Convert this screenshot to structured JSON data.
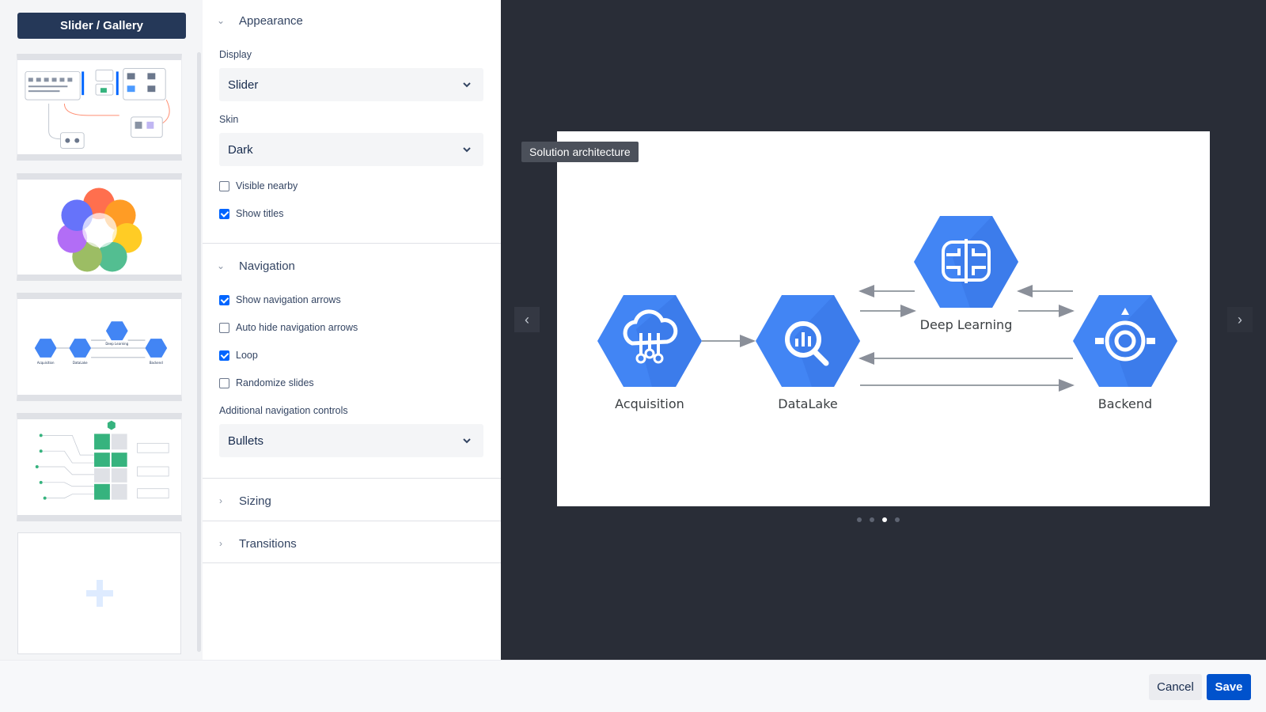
{
  "sidebar": {
    "title": "Slider / Gallery",
    "thumbnails": [
      {
        "name": "thumb-solution-flow"
      },
      {
        "name": "thumb-ux-venn"
      },
      {
        "name": "thumb-architecture",
        "labels": [
          "Acquisition",
          "DataLake",
          "Deep Learning",
          "Backend"
        ]
      },
      {
        "name": "thumb-puzzle-map"
      }
    ],
    "add_icon": "plus-icon"
  },
  "panel": {
    "appearance": {
      "title": "Appearance",
      "display_label": "Display",
      "display_value": "Slider",
      "skin_label": "Skin",
      "skin_value": "Dark",
      "visible_nearby": "Visible nearby",
      "visible_nearby_checked": false,
      "show_titles": "Show titles",
      "show_titles_checked": true
    },
    "navigation": {
      "title": "Navigation",
      "show_arrows": "Show navigation arrows",
      "show_arrows_checked": true,
      "auto_hide": "Auto hide navigation arrows",
      "auto_hide_checked": false,
      "loop": "Loop",
      "loop_checked": true,
      "randomize": "Randomize slides",
      "randomize_checked": false,
      "additional_label": "Additional navigation controls",
      "additional_value": "Bullets"
    },
    "sizing": {
      "title": "Sizing"
    },
    "transitions": {
      "title": "Transitions"
    }
  },
  "preview": {
    "slide_title": "Solution architecture",
    "nodes": [
      "Acquisition",
      "DataLake",
      "Deep Learning",
      "Backend"
    ],
    "bullets_total": 4,
    "active_bullet": 3,
    "prev_icon": "chevron-left-icon",
    "next_icon": "chevron-right-icon"
  },
  "footer": {
    "cancel": "Cancel",
    "save": "Save"
  },
  "colors": {
    "accent": "#0052cc",
    "title_button": "#253858",
    "preview_bg": "#292d37",
    "hex_blue": "#4285f4"
  }
}
